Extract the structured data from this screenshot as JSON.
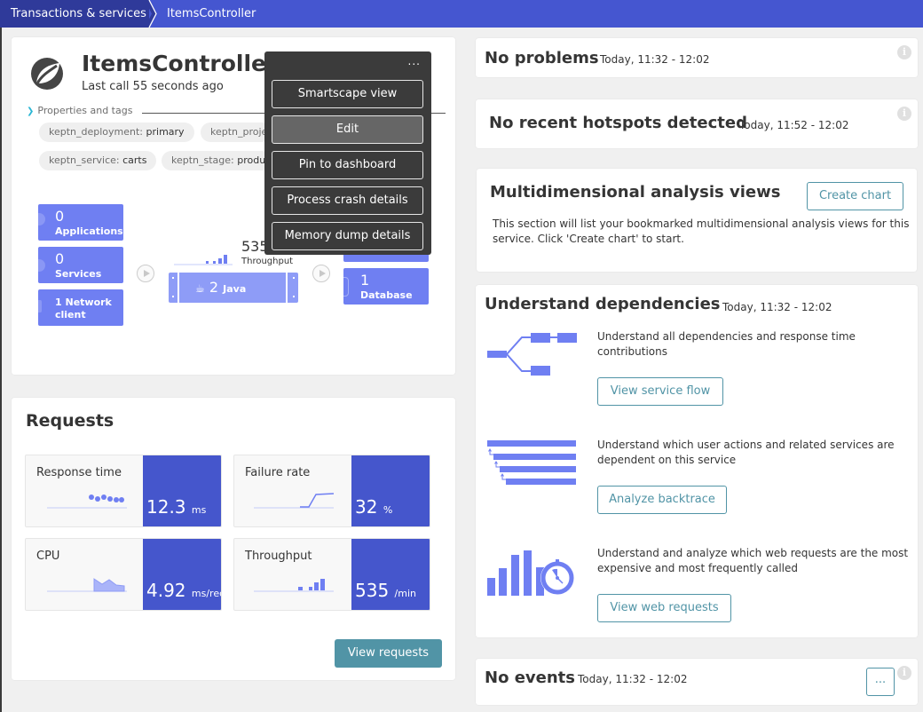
{
  "breadcrumb": {
    "items": [
      "Transactions & services",
      "ItemsController"
    ]
  },
  "service": {
    "name": "ItemsController",
    "last_call": "Last call 55 seconds ago",
    "properties_label": "Properties and tags",
    "tags": [
      {
        "key": "keptn_deployment:",
        "value": "primary"
      },
      {
        "key": "keptn_proje",
        "value": ""
      },
      {
        "key": "keptn_service:",
        "value": "carts"
      },
      {
        "key": "keptn_stage:",
        "value": "produc"
      }
    ]
  },
  "topology": {
    "callers": [
      {
        "count": "0",
        "label": "Applications"
      },
      {
        "count": "0",
        "label": "Services"
      },
      {
        "count": "",
        "label": "1 Network client"
      }
    ],
    "process": {
      "count": "2",
      "label": "Java"
    },
    "throughput_value": "535",
    "throughput_label": "Throughput",
    "callees": [
      {
        "count": "1",
        "label": "Database"
      }
    ]
  },
  "context_menu": {
    "more_label": "...",
    "items": [
      "Smartscape view",
      "Edit",
      "Pin to dashboard",
      "Process crash details",
      "Memory dump details"
    ],
    "active_index": 1
  },
  "requests": {
    "title": "Requests",
    "tiles": [
      {
        "label": "Response time",
        "value": "12.3",
        "unit": "ms"
      },
      {
        "label": "Failure rate",
        "value": "32",
        "unit": "%"
      },
      {
        "label": "CPU",
        "value": "4.92",
        "unit": "ms/req"
      },
      {
        "label": "Throughput",
        "value": "535",
        "unit": "/min"
      }
    ],
    "view_button": "View requests"
  },
  "problems": {
    "title": "No problems",
    "time": "Today, 11:32 - 12:02"
  },
  "hotspots": {
    "title": "No recent hotspots detected",
    "time": "Today, 11:52 - 12:02"
  },
  "mda": {
    "title": "Multidimensional analysis views",
    "button": "Create chart",
    "text": "This section will list your bookmarked multidimensional analysis views for this service. Click 'Create chart' to start."
  },
  "dependencies": {
    "title": "Understand dependencies",
    "time": "Today, 11:32 - 12:02",
    "items": [
      {
        "text": "Understand all dependencies and response time contributions",
        "button": "View service flow"
      },
      {
        "text": "Understand which user actions and related services are dependent on this service",
        "button": "Analyze backtrace"
      },
      {
        "text": "Understand and analyze which web requests are the most expensive and most frequently called",
        "button": "View web requests"
      }
    ]
  },
  "events": {
    "title": "No events",
    "time": "Today, 11:32 - 12:02",
    "more_label": "..."
  },
  "info_icon_glyph": "i"
}
